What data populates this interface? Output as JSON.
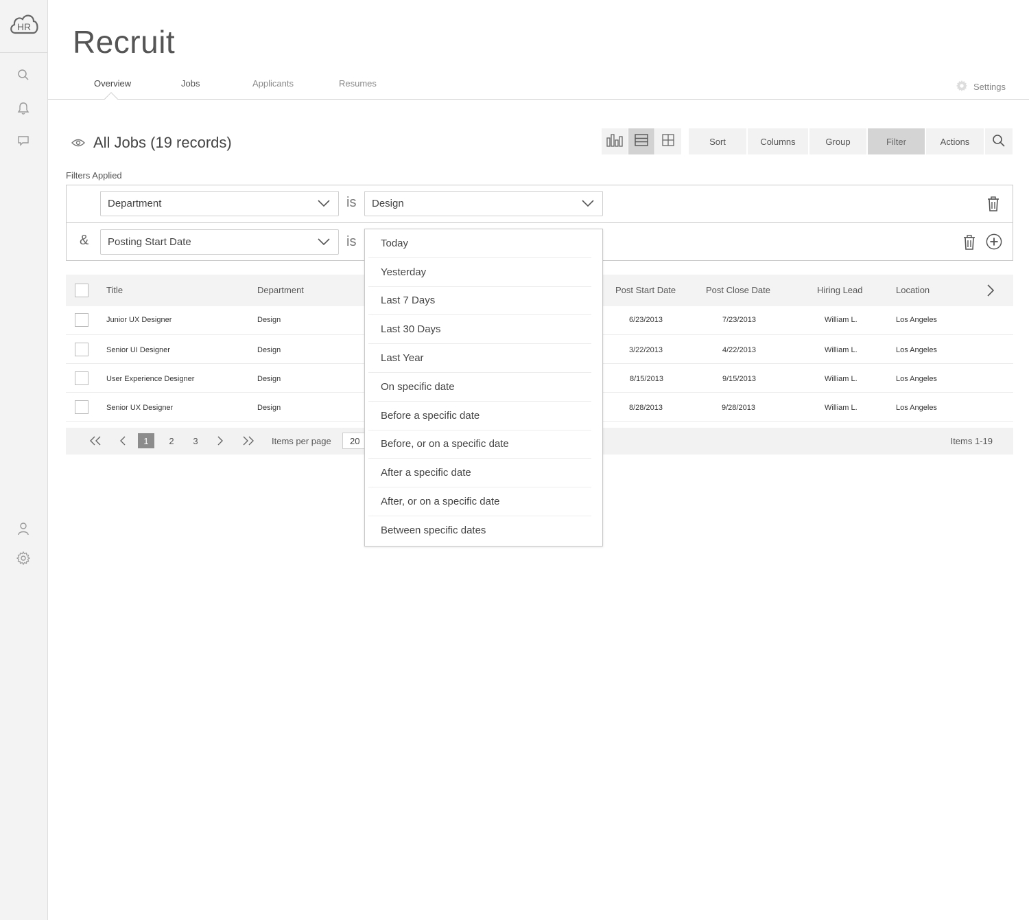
{
  "app": {
    "logo_text": "HR",
    "title": "Recruit"
  },
  "sidebar": {
    "top_icons": [
      "search-icon",
      "bell-icon",
      "chat-icon"
    ],
    "bottom_icons": [
      "user-icon",
      "gear-icon"
    ]
  },
  "nav": {
    "tabs": [
      {
        "label": "Overview",
        "active": true
      },
      {
        "label": "Jobs",
        "active": false
      },
      {
        "label": "Applicants",
        "active": false
      },
      {
        "label": "Resumes",
        "active": false
      }
    ],
    "settings_label": "Settings"
  },
  "records": {
    "title": "All Jobs (19 records)"
  },
  "toolbar": {
    "views": [
      "chart-view-icon",
      "list-view-icon",
      "grid-view-icon"
    ],
    "active_view": "list-view-icon",
    "buttons": [
      {
        "label": "Sort",
        "active": false
      },
      {
        "label": "Columns",
        "active": false
      },
      {
        "label": "Group",
        "active": false
      },
      {
        "label": "Filter",
        "active": true
      },
      {
        "label": "Actions",
        "active": false
      }
    ]
  },
  "filters": {
    "label": "Filters Applied",
    "rows": [
      {
        "connector": "",
        "field": "Department",
        "operator": "is",
        "value": "Design"
      },
      {
        "connector": "&",
        "field": "Posting Start Date",
        "operator": "is",
        "value": ""
      }
    ]
  },
  "date_options": [
    "Today",
    "Yesterday",
    "Last 7 Days",
    "Last 30 Days",
    "Last Year",
    "On specific date",
    "Before a specific date",
    "Before, or on a specific date",
    "After a specific date",
    "After, or on a specific date",
    "Between specific dates"
  ],
  "table": {
    "columns": [
      "Title",
      "Department",
      "Post Start Date",
      "Post Close Date",
      "Hiring Lead",
      "Location"
    ],
    "rows": [
      {
        "title": "Junior UX Designer",
        "department": "Design",
        "start": "6/23/2013",
        "close": "7/23/2013",
        "lead": "William L.",
        "location": "Los Angeles"
      },
      {
        "title": "Senior UI Designer",
        "department": "Design",
        "start": "3/22/2013",
        "close": "4/22/2013",
        "lead": "William L.",
        "location": "Los Angeles"
      },
      {
        "title": "User Experience Designer",
        "department": "Design",
        "start": "8/15/2013",
        "close": "9/15/2013",
        "lead": "William L.",
        "location": "Los Angeles"
      },
      {
        "title": "Senior UX Designer",
        "department": "Design",
        "start": "8/28/2013",
        "close": "9/28/2013",
        "lead": "William L.",
        "location": "Los Angeles"
      }
    ]
  },
  "pagination": {
    "pages": [
      "1",
      "2",
      "3"
    ],
    "current_page": "1",
    "items_per_page_label": "Items per page",
    "items_per_page": "20",
    "items_count": "Items 1-19"
  }
}
